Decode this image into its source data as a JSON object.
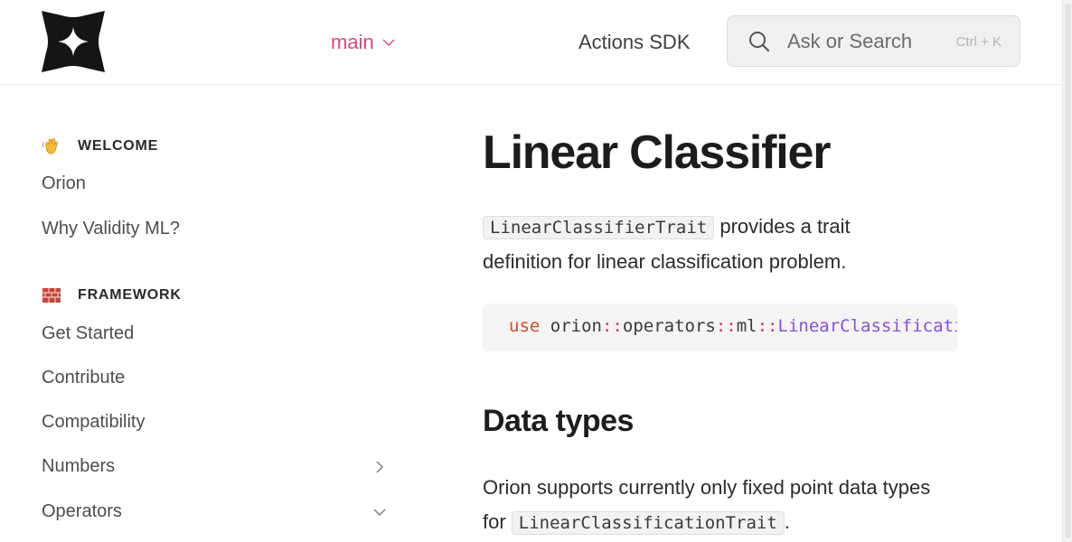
{
  "header": {
    "version_label": "main",
    "nav_link": "Actions SDK",
    "search": {
      "placeholder": "Ask or Search",
      "shortcut": "Ctrl + K"
    },
    "logo_icon": "four-point-star-logo-icon"
  },
  "sidebar": {
    "sections": [
      {
        "emoji_icon": "waving-hand-icon",
        "title": "WELCOME",
        "items": [
          {
            "label": "Orion"
          },
          {
            "label": "Why Validity ML?"
          }
        ]
      },
      {
        "emoji_icon": "brick-wall-icon",
        "title": "FRAMEWORK",
        "items": [
          {
            "label": "Get Started"
          },
          {
            "label": "Contribute"
          },
          {
            "label": "Compatibility"
          },
          {
            "label": "Numbers",
            "chevron": "right"
          },
          {
            "label": "Operators",
            "chevron": "down"
          }
        ]
      }
    ]
  },
  "main": {
    "title": "Linear Classifier",
    "intro": {
      "code": "LinearClassifierTrait",
      "text_1": " provides a trait definition for linear classification problem."
    },
    "code_block": {
      "keyword": "use",
      "path_1": "orion",
      "sep_1": "::",
      "path_2": "operators",
      "sep_2": "::",
      "path_3": "ml",
      "sep_3": "::",
      "type": "LinearClassificationTrait",
      "end": ";"
    },
    "data_types_heading": "Data types",
    "data_types_para": {
      "text_1": "Orion supports currently only fixed point data types for ",
      "code": "LinearClassificationTrait",
      "text_2": "."
    }
  },
  "colors": {
    "accent": "#e0457b",
    "code_keyword": "#d84a25",
    "code_type": "#8b4ee0"
  }
}
